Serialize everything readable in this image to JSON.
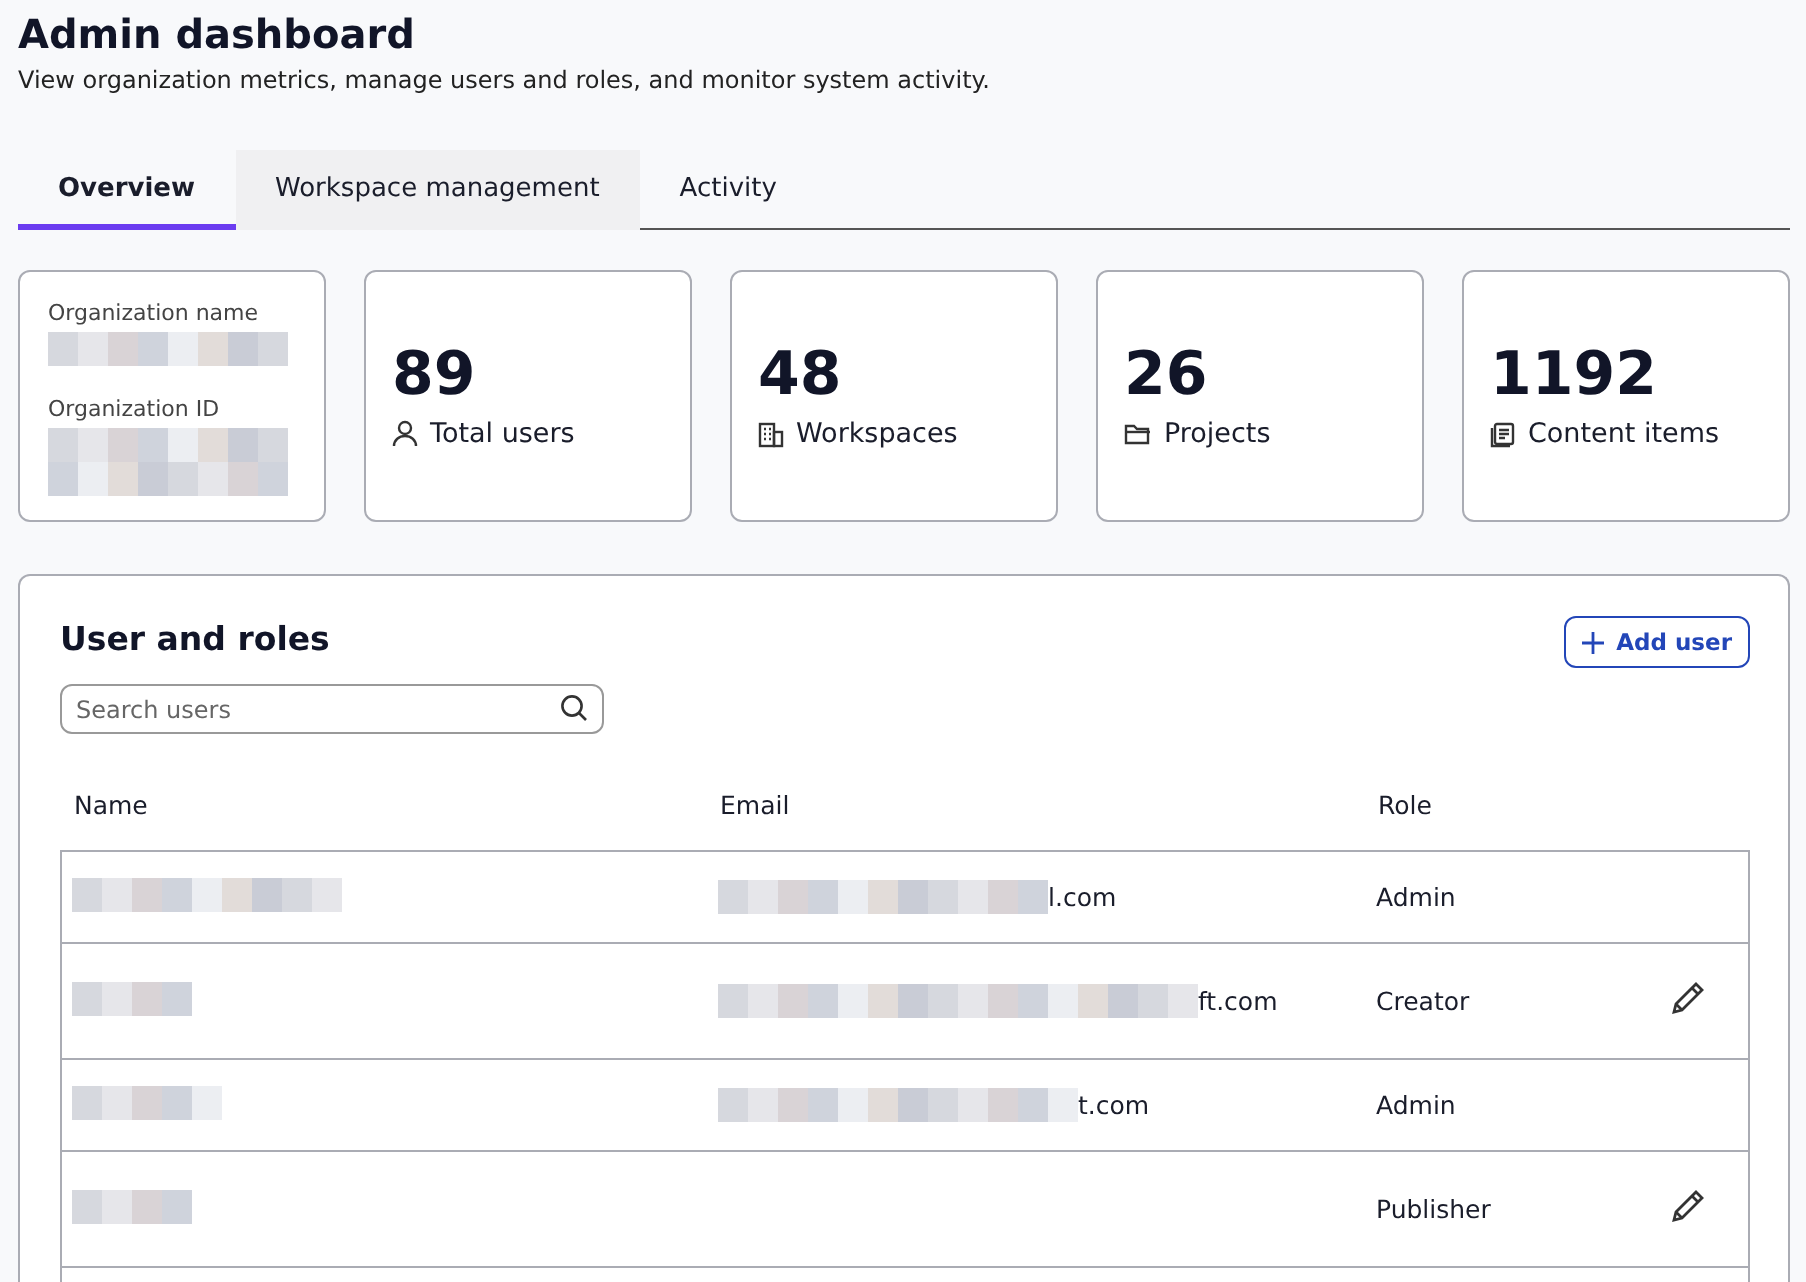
{
  "header": {
    "title": "Admin dashboard",
    "subtitle": "View organization metrics, manage users and roles, and monitor system activity."
  },
  "tabs": [
    {
      "label": "Overview",
      "selected": true,
      "hovered": false
    },
    {
      "label": "Workspace management",
      "selected": false,
      "hovered": true
    },
    {
      "label": "Activity",
      "selected": false,
      "hovered": false
    }
  ],
  "organization": {
    "name_label": "Organization name",
    "id_label": "Organization ID"
  },
  "stats": [
    {
      "value": "89",
      "label": "Total users",
      "kind": "user"
    },
    {
      "value": "48",
      "label": "Workspaces",
      "kind": "building"
    },
    {
      "value": "26",
      "label": "Projects",
      "kind": "folder"
    },
    {
      "value": "1192",
      "label": "Content items",
      "kind": "document"
    }
  ],
  "users_panel": {
    "title": "User and roles",
    "add_button": "Add user",
    "search": {
      "placeholder": "Search users"
    },
    "columns": [
      "Name",
      "Email",
      "Role"
    ],
    "rows": [
      {
        "email_suffix": "l.com",
        "role": "Admin",
        "editable": false
      },
      {
        "email_suffix": "ft.com",
        "role": "Creator",
        "editable": true
      },
      {
        "email_suffix": "t.com",
        "role": "Admin",
        "editable": false
      },
      {
        "email_suffix": "",
        "role": "Publisher",
        "editable": true
      }
    ]
  }
}
